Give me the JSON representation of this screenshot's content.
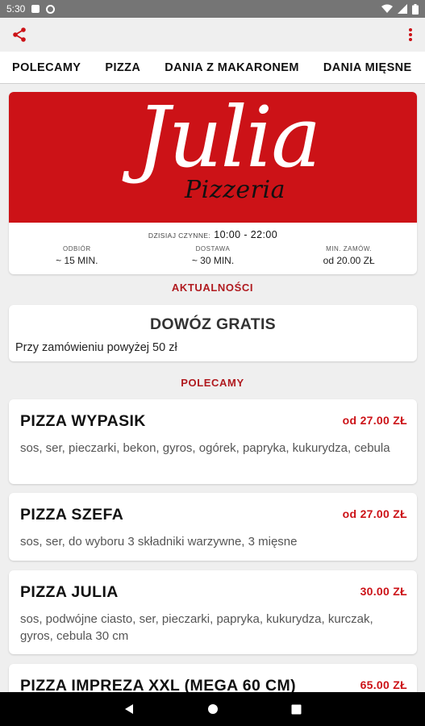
{
  "status_bar": {
    "time": "5:30"
  },
  "tabs": [
    {
      "label": "POLECAMY"
    },
    {
      "label": "PIZZA"
    },
    {
      "label": "DANIA Z MAKARONEM"
    },
    {
      "label": "DANIA MIĘSNE"
    }
  ],
  "restaurant": {
    "logo_main": "Julia",
    "logo_sub": "Pizzeria",
    "hours_label": "DZISIAJ CZYNNE:",
    "hours_value": "10:00 - 22:00",
    "stats": [
      {
        "label": "ODBIÓR",
        "value": "~ 15 MIN."
      },
      {
        "label": "DOSTAWA",
        "value": "~ 30 MIN."
      },
      {
        "label": "MIN. ZAMÓW.",
        "value": "od 20.00 ZŁ"
      }
    ]
  },
  "news": {
    "section_title": "AKTUALNOŚCI",
    "title": "DOWÓZ GRATIS",
    "text": "Przy zamówieniu powyżej 50 zł"
  },
  "menu": {
    "section_title": "POLECAMY",
    "items": [
      {
        "name": "PIZZA WYPASIK",
        "price": "od 27.00 ZŁ",
        "description": "sos, ser, pieczarki, bekon, gyros, ogórek, papryka, kukurydza, cebula"
      },
      {
        "name": "PIZZA SZEFA",
        "price": "od 27.00 ZŁ",
        "description": "sos, ser, do wyboru 3 składniki warzywne, 3 mięsne"
      },
      {
        "name": "PIZZA JULIA",
        "price": "30.00 ZŁ",
        "description": "sos, podwójne ciasto, ser, pieczarki, papryka, kukurydza, kurczak, gyros, cebula 30 cm"
      },
      {
        "name": "PIZZA IMPREZA XXL (MEGA 60 CM)",
        "price": "65.00 ZŁ",
        "description": ""
      }
    ]
  },
  "colors": {
    "accent": "#cc1217",
    "section_title": "#b01a1f",
    "banner": "#cc1217"
  },
  "icons": {
    "share": "share-icon",
    "menu": "more-vert-icon",
    "back": "back-icon",
    "home": "home-icon",
    "recents": "recents-icon"
  }
}
